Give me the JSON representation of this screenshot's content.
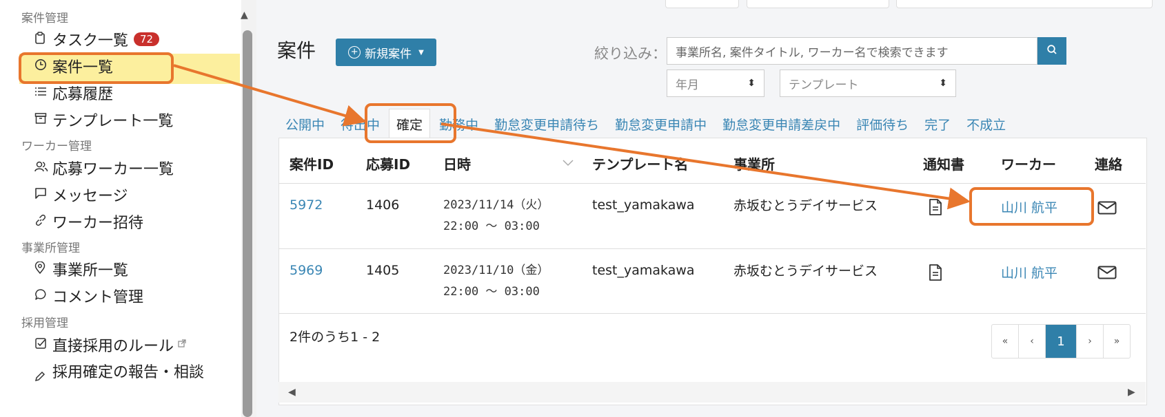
{
  "sidebar": {
    "sections": {
      "project": "案件管理",
      "worker": "ワーカー管理",
      "office": "事業所管理",
      "hiring": "採用管理"
    },
    "items": {
      "tasks": {
        "label": "タスク一覧",
        "badge": "72"
      },
      "projects": {
        "label": "案件一覧"
      },
      "applications": {
        "label": "応募履歴"
      },
      "templates": {
        "label": "テンプレート一覧"
      },
      "applicants": {
        "label": "応募ワーカー一覧"
      },
      "messages": {
        "label": "メッセージ"
      },
      "invite": {
        "label": "ワーカー招待"
      },
      "offices": {
        "label": "事業所一覧"
      },
      "comments": {
        "label": "コメント管理"
      },
      "direct_rules": {
        "label": "直接採用のルール"
      },
      "hiring_report": {
        "label": "採用確定の報告・相談"
      }
    }
  },
  "page": {
    "title": "案件",
    "new_button": "新規案件"
  },
  "filter": {
    "label": "絞り込み：",
    "search_placeholder": "事業所名, 案件タイトル, ワーカー名で検索できます",
    "month_select": "年月",
    "template_select": "テンプレート"
  },
  "tabs": [
    "公開中",
    "待出中",
    "確定",
    "勤務中",
    "勤怠変更申請待ち",
    "勤怠変更申請中",
    "勤怠変更申請差戻中",
    "評価待ち",
    "完了",
    "不成立"
  ],
  "table": {
    "headers": {
      "project_id": "案件ID",
      "app_id": "応募ID",
      "datetime": "日時",
      "template": "テンプレート名",
      "office": "事業所",
      "notice": "通知書",
      "worker": "ワーカー",
      "contact": "連絡"
    },
    "rows": [
      {
        "project_id": "5972",
        "app_id": "1406",
        "date": "2023/11/14（火）",
        "time": "22:00 〜 03:00",
        "template": "test_yamakawa",
        "office": "赤坂むとうデイサービス",
        "worker": "山川 航平"
      },
      {
        "project_id": "5969",
        "app_id": "1405",
        "date": "2023/11/10（金）",
        "time": "22:00 〜 03:00",
        "template": "test_yamakawa",
        "office": "赤坂むとうデイサービス",
        "worker": "山川 航平"
      }
    ]
  },
  "pagination": {
    "summary": "2件のうち1 - 2",
    "first": "«",
    "prev": "‹",
    "current": "1",
    "next": "›",
    "last": "»"
  },
  "colors": {
    "accent": "#2f7fa8",
    "badge": "#c9302c",
    "annotation": "#e8762d",
    "highlight": "#fcef9e"
  }
}
